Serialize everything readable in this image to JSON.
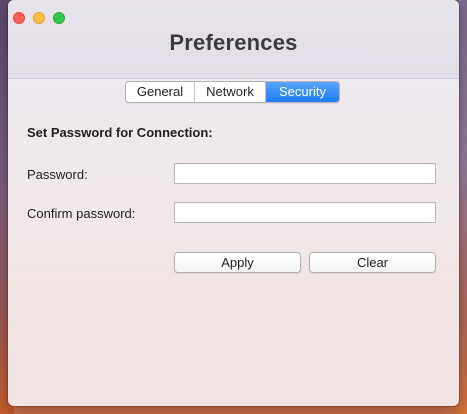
{
  "window": {
    "title": "Preferences"
  },
  "tabs": [
    {
      "label": "General",
      "selected": false
    },
    {
      "label": "Network",
      "selected": false
    },
    {
      "label": "Security",
      "selected": true
    }
  ],
  "security": {
    "section_title": "Set Password for Connection:",
    "password_label": "Password:",
    "password_value": "",
    "confirm_label": "Confirm password:",
    "confirm_value": "",
    "apply_label": "Apply",
    "clear_label": "Clear"
  },
  "colors": {
    "selected_tab": "#1c7bf5",
    "close": "#fc605b",
    "minimize": "#fdbc40",
    "zoom": "#34c84a"
  }
}
